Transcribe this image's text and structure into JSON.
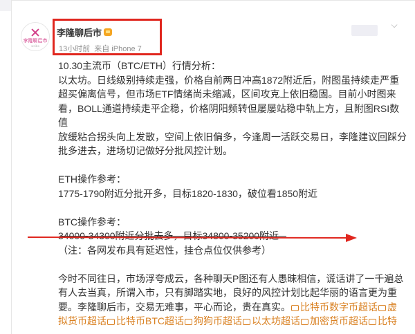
{
  "post": {
    "username": "李隆聊后市",
    "avatar_text": "李隆聊后市",
    "avatar_sub": "weibo",
    "time": "13小时前",
    "source": "来自 iPhone 7",
    "lines": {
      "title": "10.30主流币（BTC/ETH）行情分析：",
      "p1_1": "以太坊。日线级别持续走强，价格自前两日冲高1872附近后，附图虽持续走严重",
      "p1_2": "超买偏离信号，但市场ETF情绪尚未缩减，区间攻克上依旧稳固。目前小时图来",
      "p1_3": "看，BOLL通道持续走平企稳，价格阴阳频转但屡屡站稳中轨上方，且附图RSI数值",
      "p1_4": "放缓粘合拐头向上发散，空间上依旧偏多，今逢周一活跃交易日，李隆建议回踩分",
      "p1_5": "批多进去，进场切记做好分批风控计划。",
      "eth_title": "ETH操作参考：",
      "eth_line": "1775-1790附近分批开多，目标1820-1830，破位看1850附近",
      "btc_title": "BTC操作参考：",
      "btc_line": "34000-34300附近分批去多，目标34800-35200附近",
      "note": "（注：各网发布具有延迟性，挂仓点位仅供参考）",
      "p2_1": "今时不同往日，市场浮夸成云，各种聊天P图还有人愚昧相信，谎话讲了一千遍总",
      "p2_2": "有人去当真，所谓入市，只有脚踏实地，良好的风控计划比起华丽的语言更为重",
      "p2_3a": "要。李隆聊后市，交易无难事，平心而论，贵在真实。",
      "tag1": "比特币数字币超话",
      "tag2a": "虚",
      "tag2b": "拟货币超话",
      "tag3": "比特币BTC超话",
      "tag4": "狗狗币超话",
      "tag5": "以太坊超话",
      "tag6": "加密货币超话",
      "tag7": "比特"
    }
  },
  "colors": {
    "highlight_box": "#e0261e",
    "tag": "#d98021",
    "arrow": "#e0261e"
  }
}
